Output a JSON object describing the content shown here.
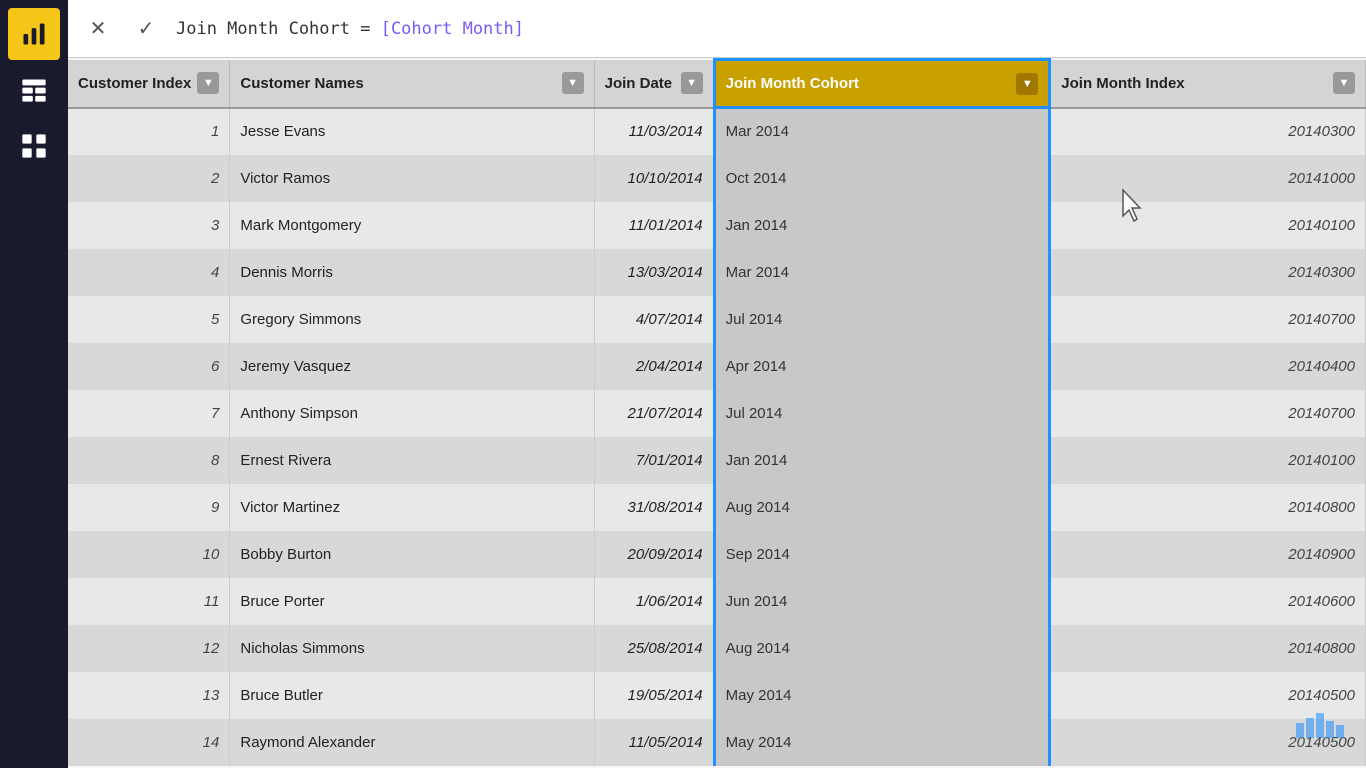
{
  "sidebar": {
    "icons": [
      {
        "name": "bar-chart-icon",
        "label": "Bar Chart",
        "active": true
      },
      {
        "name": "table-icon",
        "label": "Table",
        "active": false
      },
      {
        "name": "model-icon",
        "label": "Model",
        "active": false
      }
    ]
  },
  "formula_bar": {
    "cancel_label": "✕",
    "confirm_label": "✓",
    "formula_text": "Join Month Cohort = [Cohort Month]",
    "formula_plain": "Join Month Cohort = ",
    "formula_colored": "[Cohort Month]"
  },
  "table": {
    "columns": [
      {
        "id": "customer_index",
        "label": "Customer Index",
        "highlighted": false
      },
      {
        "id": "customer_names",
        "label": "Customer Names",
        "highlighted": false
      },
      {
        "id": "join_date",
        "label": "Join Date",
        "highlighted": false
      },
      {
        "id": "join_month_cohort",
        "label": "Join Month Cohort",
        "highlighted": true
      },
      {
        "id": "join_month_index",
        "label": "Join Month Index",
        "highlighted": false
      }
    ],
    "rows": [
      {
        "index": 1,
        "name": "Jesse Evans",
        "date": "11/03/2014",
        "cohort": "Mar 2014",
        "cohort_index": "20140300"
      },
      {
        "index": 2,
        "name": "Victor Ramos",
        "date": "10/10/2014",
        "cohort": "Oct 2014",
        "cohort_index": "20141000"
      },
      {
        "index": 3,
        "name": "Mark Montgomery",
        "date": "11/01/2014",
        "cohort": "Jan 2014",
        "cohort_index": "20140100"
      },
      {
        "index": 4,
        "name": "Dennis Morris",
        "date": "13/03/2014",
        "cohort": "Mar 2014",
        "cohort_index": "20140300"
      },
      {
        "index": 5,
        "name": "Gregory Simmons",
        "date": "4/07/2014",
        "cohort": "Jul 2014",
        "cohort_index": "20140700"
      },
      {
        "index": 6,
        "name": "Jeremy Vasquez",
        "date": "2/04/2014",
        "cohort": "Apr 2014",
        "cohort_index": "20140400"
      },
      {
        "index": 7,
        "name": "Anthony Simpson",
        "date": "21/07/2014",
        "cohort": "Jul 2014",
        "cohort_index": "20140700"
      },
      {
        "index": 8,
        "name": "Ernest Rivera",
        "date": "7/01/2014",
        "cohort": "Jan 2014",
        "cohort_index": "20140100"
      },
      {
        "index": 9,
        "name": "Victor Martinez",
        "date": "31/08/2014",
        "cohort": "Aug 2014",
        "cohort_index": "20140800"
      },
      {
        "index": 10,
        "name": "Bobby Burton",
        "date": "20/09/2014",
        "cohort": "Sep 2014",
        "cohort_index": "20140900"
      },
      {
        "index": 11,
        "name": "Bruce Porter",
        "date": "1/06/2014",
        "cohort": "Jun 2014",
        "cohort_index": "20140600"
      },
      {
        "index": 12,
        "name": "Nicholas Simmons",
        "date": "25/08/2014",
        "cohort": "Aug 2014",
        "cohort_index": "20140800"
      },
      {
        "index": 13,
        "name": "Bruce Butler",
        "date": "19/05/2014",
        "cohort": "May 2014",
        "cohort_index": "20140500"
      },
      {
        "index": 14,
        "name": "Raymond Alexander",
        "date": "11/05/2014",
        "cohort": "May 2014",
        "cohort_index": "20140500"
      }
    ]
  },
  "colors": {
    "sidebar_bg": "#1a1a2e",
    "active_icon_bg": "#f5c518",
    "header_bg": "#d4d4d4",
    "highlighted_header_bg": "#c8a000",
    "highlight_border": "#1e90ff",
    "odd_row": "#e8e8e8",
    "even_row": "#d8d8d8"
  }
}
